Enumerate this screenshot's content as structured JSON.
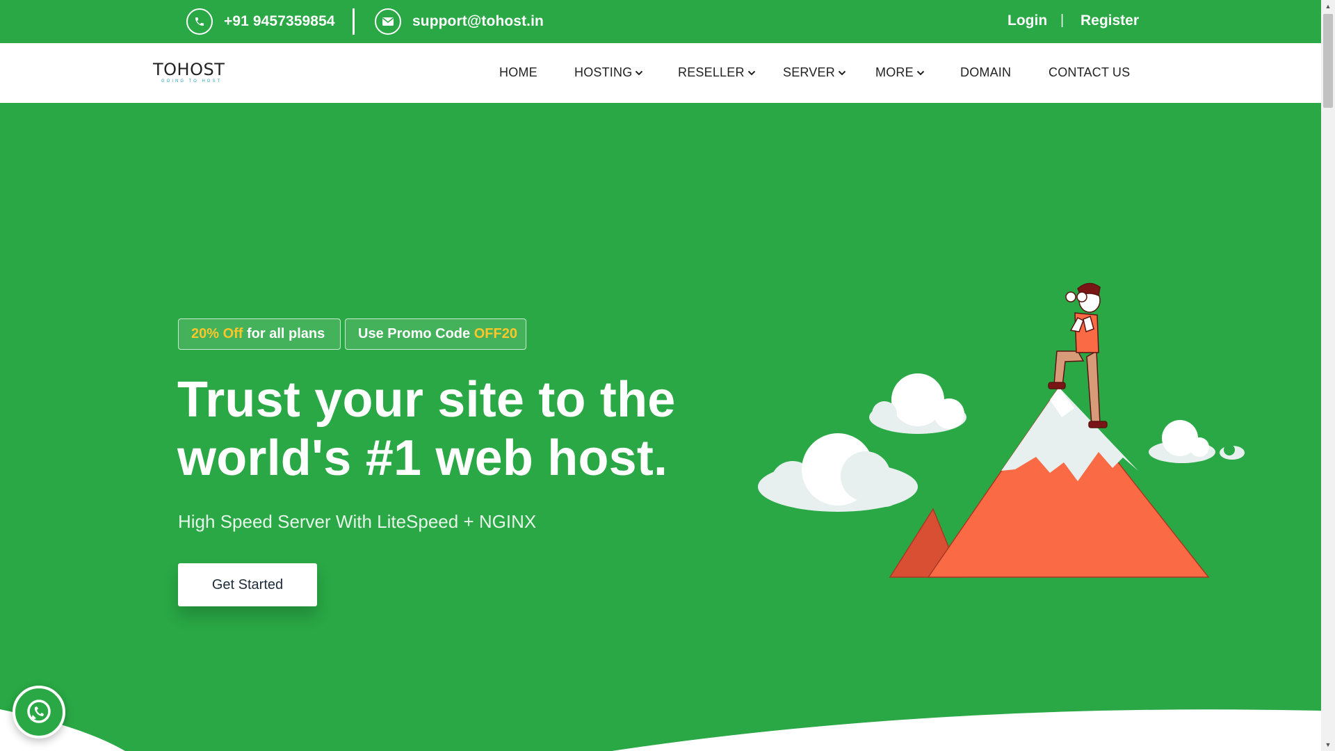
{
  "topbar": {
    "phone": "+91 9457359854",
    "email": "support@tohost.in",
    "login": "Login",
    "separator": "|",
    "register": "Register"
  },
  "brand": {
    "name": "TOHOST",
    "tagline": "GOING TO HOST"
  },
  "nav": {
    "items": [
      {
        "label": "HOME"
      },
      {
        "label": "HOSTING"
      },
      {
        "label": "RESELLER"
      },
      {
        "label": "SERVER"
      },
      {
        "label": "MORE"
      },
      {
        "label": "DOMAIN"
      },
      {
        "label": "CONTACT US"
      }
    ]
  },
  "hero": {
    "badge1_highlight": "20% Off",
    "badge1_rest": " for all plans",
    "badge2_prefix": "Use Promo Code ",
    "badge2_code": "OFF20",
    "headline_line1": "Trust your site to the",
    "headline_line2": "world's #1 web host.",
    "subheadline": "High Speed Server With LiteSpeed + NGINX",
    "cta": "Get Started"
  },
  "colors": {
    "brand_green": "#29a845",
    "highlight_yellow": "#ffc629",
    "mountain_orange": "#f96a45"
  },
  "icons": {
    "phone": "phone-icon",
    "email": "envelope-icon",
    "dropdown": "chevron-down-icon",
    "chat": "whatsapp-icon"
  }
}
